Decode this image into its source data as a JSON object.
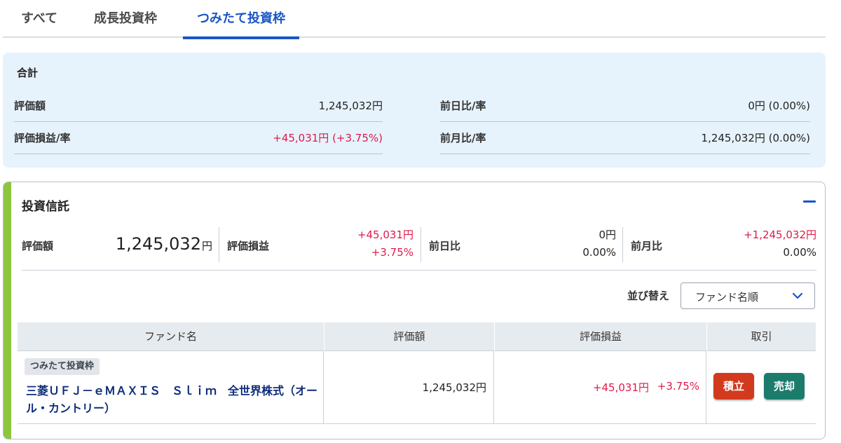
{
  "tabs": [
    {
      "label": "すべて"
    },
    {
      "label": "成長投資枠"
    },
    {
      "label": "つみたて投資枠"
    }
  ],
  "summary": {
    "title": "合計",
    "valuation_label": "評価額",
    "valuation_value": "1,245,032円",
    "pl_label": "評価損益/率",
    "pl_value": "+45,031円 (+3.75%)",
    "prev_day_label": "前日比/率",
    "prev_day_value": "0円 (0.00%)",
    "prev_month_label": "前月比/率",
    "prev_month_value": "1,245,032円 (0.00%)"
  },
  "fund_card": {
    "title": "投資信託",
    "valuation_label": "評価額",
    "valuation_value": "1,245,032",
    "valuation_unit": "円",
    "pl_label": "評価損益",
    "pl_amount": "+45,031円",
    "pl_rate": "+3.75%",
    "prev_day_label": "前日比",
    "prev_day_amount": "0円",
    "prev_day_rate": "0.00%",
    "prev_month_label": "前月比",
    "prev_month_amount": "+1,245,032円",
    "prev_month_rate": "0.00%",
    "sort_label": "並び替え",
    "sort_selected": "ファンド名順"
  },
  "table": {
    "headers": [
      "ファンド名",
      "評価額",
      "評価損益",
      "取引"
    ],
    "rows": [
      {
        "badge": "つみたて投資枠",
        "fund_name": "三菱ＵＦＪ－ｅＭＡＸＩＳ　Ｓｌｉｍ　全世界株式（オール・カントリー）",
        "valuation": "1,245,032円",
        "pl_amount": "+45,031円",
        "pl_rate": "+3.75%",
        "buy_label": "積立",
        "sell_label": "売却"
      }
    ]
  },
  "colors": {
    "accent_blue": "#1a55c4",
    "gain_red": "#e0194a",
    "card_accent_green": "#8cc63f",
    "buy_button": "#d23a1e",
    "sell_button": "#1b7c6c",
    "summary_bg": "#e6f3fc"
  },
  "icons": {
    "collapse": "minus-icon",
    "sort_dropdown": "chevron-down-icon"
  }
}
